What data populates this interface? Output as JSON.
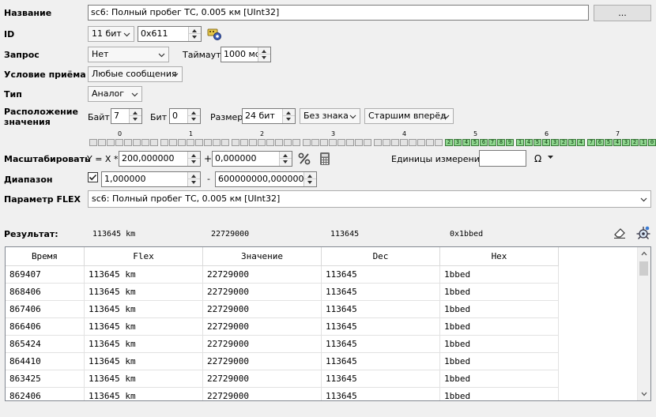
{
  "form": {
    "name_label": "Название",
    "name_value": "sc6: Полный пробег ТС, 0.005 км [UInt32]",
    "browse_label": "...",
    "id_label": "ID",
    "id_type": "11 бит",
    "id_value": "0x611",
    "request_label": "Запрос",
    "request_value": "Нет",
    "timeout_label": "Таймаут",
    "timeout_value": "1000 мс",
    "receive_label": "Условие приёма",
    "receive_value": "Любые сообщения",
    "type_label": "Тип",
    "type_value": "Аналог",
    "location_label_1": "Расположение",
    "location_label_2": "значения",
    "byte_label": "Байт",
    "byte_value": "7",
    "bit_label": "Бит",
    "bit_value": "0",
    "size_label": "Размер",
    "size_value": "24 бит",
    "sign_value": "Без знака",
    "order_value": "Старшим вперёд",
    "scale_label": "Масштабировать",
    "scale_formula": "Y = X *",
    "scale_value": "200,000000",
    "plus_label": "+",
    "offset_value": "0,000000",
    "units_label": "Единицы измерения:",
    "units_value": "",
    "omega_label": "Ω",
    "range_label": "Диапазон",
    "range_min": "1,000000",
    "range_dash": "-",
    "range_max": "600000000,000000",
    "flex_label": "Параметр FLEX",
    "flex_value": "sc6: Полный пробег ТС, 0.005 км [UInt32]"
  },
  "bytes": {
    "labels": [
      "0",
      "1",
      "2",
      "3",
      "4",
      "5",
      "6",
      "7"
    ],
    "active": [
      [],
      [],
      [],
      [],
      [],
      [
        "2",
        "3",
        "4",
        "5",
        "6",
        "7",
        "8",
        "9"
      ],
      [
        "1",
        "4",
        "5",
        "4",
        "3",
        "2",
        "3",
        "4"
      ],
      [
        "7",
        "6",
        "5",
        "4",
        "3",
        "2",
        "1",
        "0"
      ]
    ]
  },
  "result": {
    "label": "Результат:",
    "flex": "113645 km",
    "value": "22729000",
    "dec": "113645",
    "hex": "0x1bbed"
  },
  "table": {
    "columns": [
      "Время",
      "Flex",
      "Значение",
      "Dec",
      "Hex"
    ],
    "rows": [
      [
        "869407",
        "113645 km",
        "22729000",
        "113645",
        "1bbed"
      ],
      [
        "868406",
        "113645 km",
        "22729000",
        "113645",
        "1bbed"
      ],
      [
        "867406",
        "113645 km",
        "22729000",
        "113645",
        "1bbed"
      ],
      [
        "866406",
        "113645 km",
        "22729000",
        "113645",
        "1bbed"
      ],
      [
        "865424",
        "113645 km",
        "22729000",
        "113645",
        "1bbed"
      ],
      [
        "864410",
        "113645 km",
        "22729000",
        "113645",
        "1bbed"
      ],
      [
        "863425",
        "113645 km",
        "22729000",
        "113645",
        "1bbed"
      ],
      [
        "862406",
        "113645 km",
        "22729000",
        "113645",
        "1bbed"
      ]
    ]
  },
  "icons": {
    "id_tool": "id-settings-icon",
    "percent": "percent-icon",
    "calculator": "calculator-icon",
    "eraser": "eraser-icon",
    "analyze": "analyze-icon"
  }
}
